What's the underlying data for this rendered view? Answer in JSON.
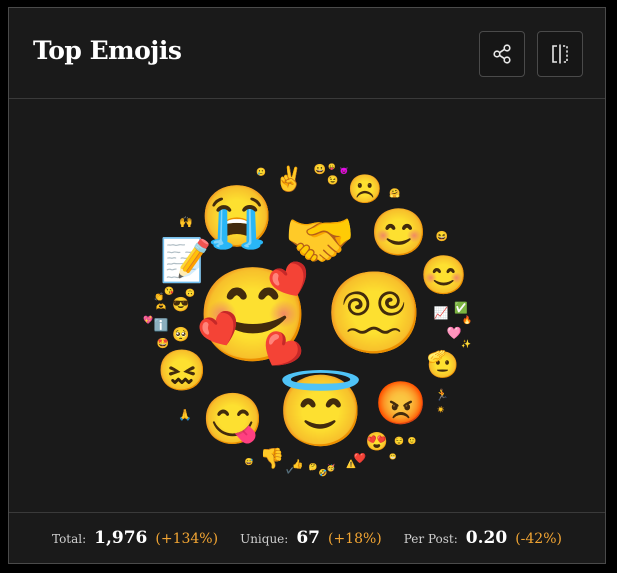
{
  "header": {
    "title": "Top Emojis",
    "share_icon": "share-icon",
    "split_icon": "split-view-icon"
  },
  "emoji_cloud": {
    "emojis": [
      {
        "name": "smiling-face-with-hearts",
        "glyph": "🥰"
      },
      {
        "name": "face-with-spiral-eyes",
        "glyph": "😵‍💫"
      },
      {
        "name": "smiling-face-with-halo",
        "glyph": "😇"
      },
      {
        "name": "loudly-crying-face",
        "glyph": "😭"
      },
      {
        "name": "handshake",
        "glyph": "🤝"
      },
      {
        "name": "smiling-face-with-smiling-eyes",
        "glyph": "😊"
      },
      {
        "name": "smiling-face",
        "glyph": "😊"
      },
      {
        "name": "face-savoring-food",
        "glyph": "😋"
      },
      {
        "name": "confounded-face",
        "glyph": "😖"
      },
      {
        "name": "angry-face",
        "glyph": "😡"
      },
      {
        "name": "memo",
        "glyph": "📝"
      },
      {
        "name": "frowning-face",
        "glyph": "☹️"
      },
      {
        "name": "victory-hand",
        "glyph": "✌️"
      },
      {
        "name": "face-with-hand-over-mouth",
        "glyph": "🫡"
      },
      {
        "name": "smiling-face-with-heart-eyes",
        "glyph": "😍"
      },
      {
        "name": "thumbs-down",
        "glyph": "👎"
      },
      {
        "name": "pleading-face",
        "glyph": "🥺"
      },
      {
        "name": "smiling-face-with-sunglasses",
        "glyph": "😎"
      },
      {
        "name": "information",
        "glyph": "ℹ️"
      },
      {
        "name": "pink-heart",
        "glyph": "🩷"
      },
      {
        "name": "chart-increasing",
        "glyph": "📈"
      },
      {
        "name": "check-mark-button",
        "glyph": "✅"
      },
      {
        "name": "person-running",
        "glyph": "🏃"
      },
      {
        "name": "folded-hands",
        "glyph": "🙏"
      },
      {
        "name": "raising-hands",
        "glyph": "🙌"
      },
      {
        "name": "clapping-hands",
        "glyph": "👏"
      },
      {
        "name": "red-heart",
        "glyph": "❤️"
      },
      {
        "name": "thumbs-up",
        "glyph": "👍"
      },
      {
        "name": "grinning-face",
        "glyph": "😀"
      },
      {
        "name": "star-struck",
        "glyph": "🤩"
      },
      {
        "name": "winking-face",
        "glyph": "😉"
      },
      {
        "name": "grinning-squinting-face",
        "glyph": "😆"
      },
      {
        "name": "smiling-face-with-tear",
        "glyph": "🥲"
      },
      {
        "name": "hugging-face",
        "glyph": "🤗"
      },
      {
        "name": "face-with-tongue",
        "glyph": "😛"
      },
      {
        "name": "smiling-face-with-horns",
        "glyph": "😈"
      },
      {
        "name": "rolling-on-the-floor-laughing",
        "glyph": "🤣"
      },
      {
        "name": "face-blowing-a-kiss",
        "glyph": "😘"
      },
      {
        "name": "sparkling-heart",
        "glyph": "💖"
      },
      {
        "name": "heart-hands",
        "glyph": "🫶"
      },
      {
        "name": "warning",
        "glyph": "⚠️"
      },
      {
        "name": "thinking-face",
        "glyph": "🤔"
      },
      {
        "name": "partying-face",
        "glyph": "🥳"
      },
      {
        "name": "relieved-face",
        "glyph": "😌"
      },
      {
        "name": "slightly-smiling-face",
        "glyph": "🙂"
      },
      {
        "name": "sun",
        "glyph": "☀️"
      },
      {
        "name": "fire",
        "glyph": "🔥"
      },
      {
        "name": "sparkles",
        "glyph": "✨"
      },
      {
        "name": "check-mark",
        "glyph": "✔️"
      },
      {
        "name": "grinning-face-with-sweat",
        "glyph": "😅"
      },
      {
        "name": "beaming-face",
        "glyph": "😁"
      },
      {
        "name": "upside-down-face",
        "glyph": "🙃"
      }
    ]
  },
  "stats": [
    {
      "label": "Total:",
      "value": "1,976",
      "change": "(+134%)"
    },
    {
      "label": "Unique:",
      "value": "67",
      "change": "(+18%)"
    },
    {
      "label": "Per Post:",
      "value": "0.20",
      "change": "(-42%)"
    }
  ],
  "colors": {
    "background": "#1a1a1a",
    "border": "#4a4a4a",
    "accent_change": "#f2a533",
    "text": "#ffffff"
  }
}
